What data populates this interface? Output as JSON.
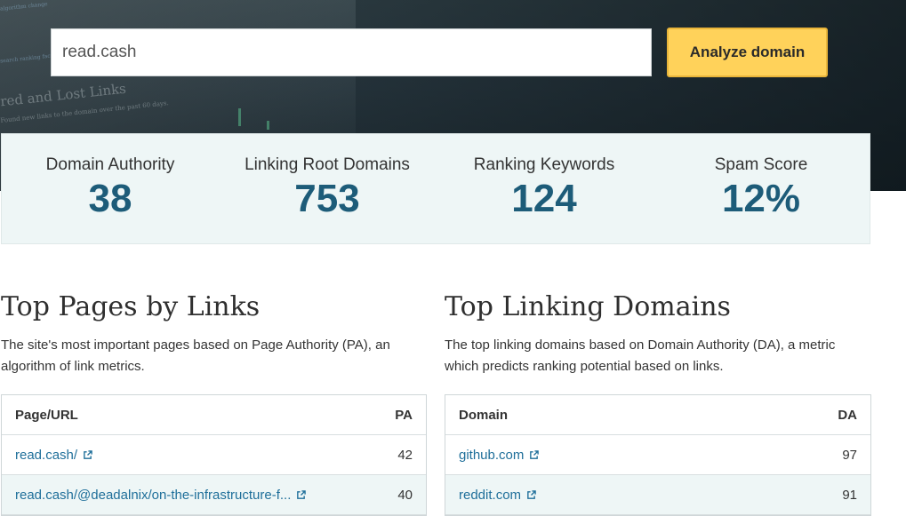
{
  "search": {
    "value": "read.cash"
  },
  "analyze_label": "Analyze domain",
  "hero_bg": {
    "line1": "red and Lost Links",
    "line2": "Found new links to the domain over the past 60 days.",
    "line3": "search ranking factors",
    "line4": "algorithm change"
  },
  "stats": [
    {
      "label": "Domain Authority",
      "value": "38"
    },
    {
      "label": "Linking Root Domains",
      "value": "753"
    },
    {
      "label": "Ranking Keywords",
      "value": "124"
    },
    {
      "label": "Spam Score",
      "value": "12%"
    }
  ],
  "top_pages": {
    "title": "Top Pages by Links",
    "desc": "The site's most important pages based on Page Authority (PA), an algorithm of link metrics.",
    "col1": "Page/URL",
    "col2": "PA",
    "rows": [
      {
        "url": "read.cash/",
        "pa": "42"
      },
      {
        "url": "read.cash/@deadalnix/on-the-infrastructure-f...",
        "pa": "40"
      }
    ]
  },
  "top_domains": {
    "title": "Top Linking Domains",
    "desc": "The top linking domains based on Domain Authority (DA), a metric which predicts ranking potential based on links.",
    "col1": "Domain",
    "col2": "DA",
    "rows": [
      {
        "domain": "github.com",
        "da": "97"
      },
      {
        "domain": "reddit.com",
        "da": "91"
      }
    ]
  },
  "colors": {
    "accent": "#1d5c79",
    "button": "#ffd25a",
    "link": "#1f6f9a",
    "panel": "#eef6f6"
  },
  "icons": {
    "external": "external-link-icon"
  }
}
